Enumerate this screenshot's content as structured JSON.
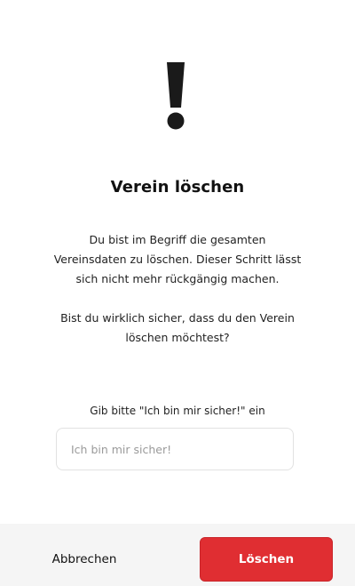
{
  "dialog": {
    "icon": "exclamation-icon",
    "title": "Verein löschen",
    "message_paragraph_1": "Du bist im Begriff die gesamten Vereinsdaten zu löschen. Dieser Schritt lässt sich nicht mehr rückgängig machen.",
    "message_paragraph_2": "Bist du wirklich sicher, dass du den Verein löschen möchtest?",
    "confirm_label": "Gib bitte \"Ich bin mir sicher!\" ein",
    "confirm_input": {
      "value": "",
      "placeholder": "Ich bin mir sicher!"
    }
  },
  "footer": {
    "cancel_label": "Abbrechen",
    "delete_label": "Löschen"
  },
  "colors": {
    "danger": "#e02e32",
    "footer_background": "#f5f5f5",
    "icon": "#1a1a1a"
  }
}
